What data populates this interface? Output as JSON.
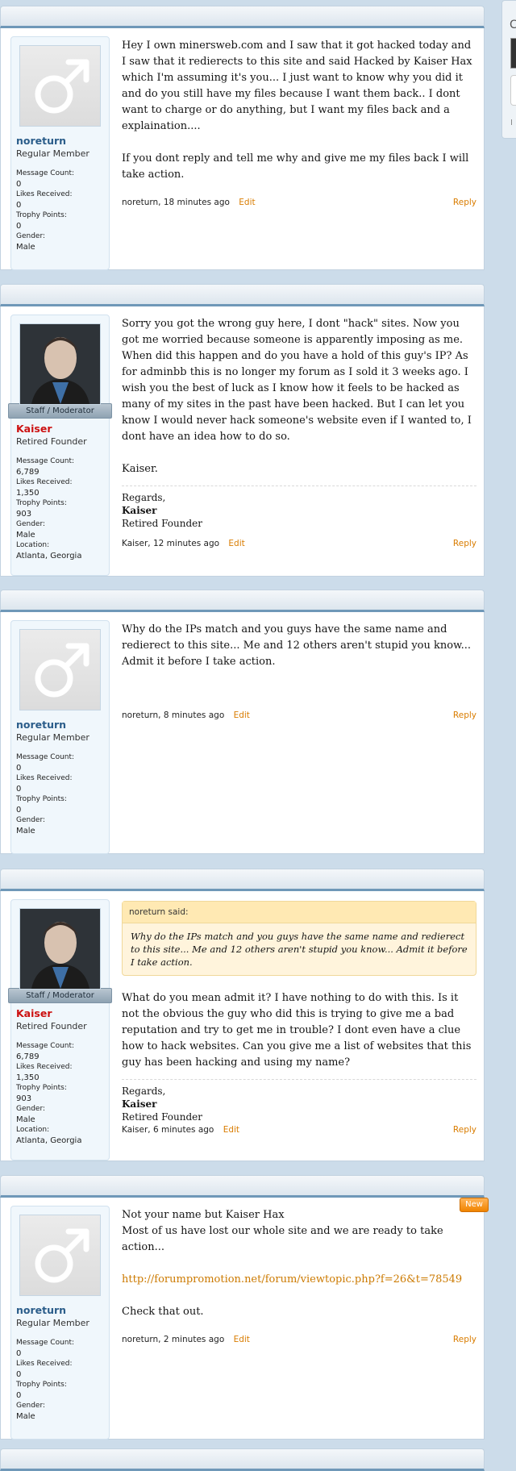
{
  "sidebar": {
    "heading_fragment": "C",
    "footer_fragment": "I"
  },
  "posts": [
    {
      "username": "noreturn",
      "usertitle": "Regular Member",
      "staff": false,
      "stats": [
        {
          "label": "Message Count:",
          "value": "0"
        },
        {
          "label": "Likes Received:",
          "value": "0"
        },
        {
          "label": "Trophy Points:",
          "value": "0"
        },
        {
          "label": "Gender:",
          "value": "Male"
        }
      ],
      "paragraphs": [
        "Hey I own minersweb.com and I saw that it got hacked today and I saw that it redierects to this site and said Hacked by Kaiser Hax which I'm assuming it's you... I just want to know why you did it and do you still have my files because I want them back.. I dont want to charge or do anything, but I want my files back and a explaination....",
        "If you dont reply and tell me why and give me my files back I will take action."
      ],
      "author_time": "noreturn, 18 minutes ago",
      "edit": "Edit",
      "reply": "Reply"
    },
    {
      "username": "Kaiser",
      "usertitle": "Retired Founder",
      "staff": true,
      "staff_banner": "Staff / Moderator",
      "stats": [
        {
          "label": "Message Count:",
          "value": "6,789"
        },
        {
          "label": "Likes Received:",
          "value": "1,350"
        },
        {
          "label": "Trophy Points:",
          "value": "903"
        },
        {
          "label": "Gender:",
          "value": "Male"
        },
        {
          "label": "Location:",
          "value": "Atlanta, Georgia"
        }
      ],
      "paragraphs": [
        "Sorry you got the wrong guy here, I dont \"hack\" sites. Now you got me worried because someone is apparently imposing as me. When did this happen and do you have a hold of this guy's IP? As for adminbb this is no longer my forum as I sold it 3 weeks ago. I wish you the best of luck as I know how it feels to be hacked as many of my sites in the past have been hacked. But I can let you know I would never hack someone's website even if I wanted to, I dont have an idea how to do so.",
        "Kaiser."
      ],
      "signature": {
        "regards": "Regards,",
        "name": "Kaiser",
        "title": "Retired Founder"
      },
      "author_time": "Kaiser, 12 minutes ago",
      "edit": "Edit",
      "reply": "Reply"
    },
    {
      "username": "noreturn",
      "usertitle": "Regular Member",
      "staff": false,
      "stats": [
        {
          "label": "Message Count:",
          "value": "0"
        },
        {
          "label": "Likes Received:",
          "value": "0"
        },
        {
          "label": "Trophy Points:",
          "value": "0"
        },
        {
          "label": "Gender:",
          "value": "Male"
        }
      ],
      "paragraphs": [
        "Why do the IPs match and you guys have the same name and redierect to this site... Me and 12 others aren't stupid you know... Admit it before I take action."
      ],
      "author_time": "noreturn, 8 minutes ago",
      "edit": "Edit",
      "reply": "Reply"
    },
    {
      "username": "Kaiser",
      "usertitle": "Retired Founder",
      "staff": true,
      "staff_banner": "Staff / Moderator",
      "stats": [
        {
          "label": "Message Count:",
          "value": "6,789"
        },
        {
          "label": "Likes Received:",
          "value": "1,350"
        },
        {
          "label": "Trophy Points:",
          "value": "903"
        },
        {
          "label": "Gender:",
          "value": "Male"
        },
        {
          "label": "Location:",
          "value": "Atlanta, Georgia"
        }
      ],
      "quote": {
        "author": "noreturn said:",
        "text": "Why do the IPs match and you guys have the same name and redierect to this site... Me and 12 others aren't stupid you know... Admit it before I take action."
      },
      "paragraphs": [
        "What do you mean admit it? I have nothing to do with this. Is it not the obvious the guy who did this is trying to give me a bad reputation and try to get me in trouble? I dont even have a clue how to hack websites. Can you give me a list of websites that this guy has been hacking and using my name?"
      ],
      "signature": {
        "regards": "Regards,",
        "name": "Kaiser",
        "title": "Retired Founder"
      },
      "author_time": "Kaiser, 6 minutes ago",
      "edit": "Edit",
      "reply": "Reply"
    },
    {
      "username": "noreturn",
      "usertitle": "Regular Member",
      "staff": false,
      "new_badge": "New",
      "stats": [
        {
          "label": "Message Count:",
          "value": "0"
        },
        {
          "label": "Likes Received:",
          "value": "0"
        },
        {
          "label": "Trophy Points:",
          "value": "0"
        },
        {
          "label": "Gender:",
          "value": "Male"
        }
      ],
      "lines": [
        "Not your name but Kaiser Hax",
        "Most of us have lost our whole site and we are ready to take action..."
      ],
      "link": "http://forumpromotion.net/forum/viewtopic.php?f=26&t=78549",
      "closing": "Check that out.",
      "author_time": "noreturn, 2 minutes ago",
      "edit": "Edit",
      "reply": "Reply"
    }
  ]
}
